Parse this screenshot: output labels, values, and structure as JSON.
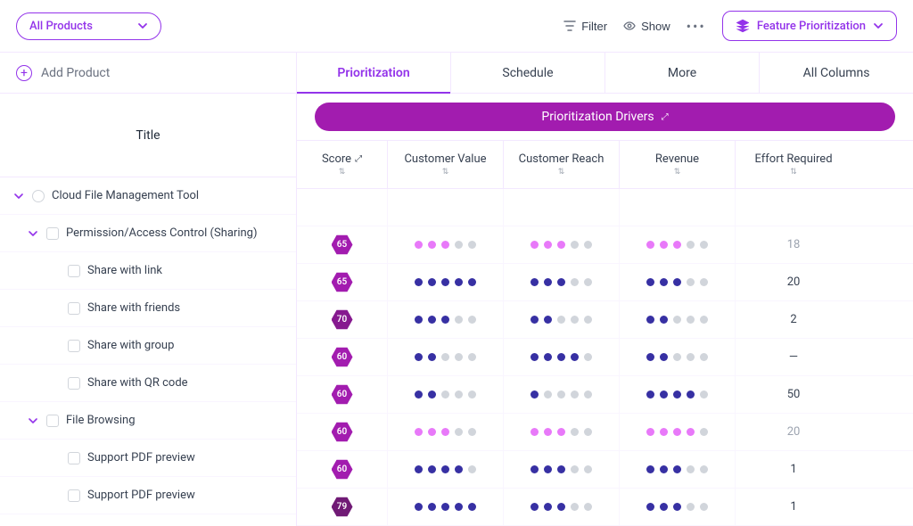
{
  "topbar": {
    "product_select": "All Products",
    "filter": "Filter",
    "show": "Show",
    "feature_btn": "Feature Prioritization"
  },
  "left": {
    "add_product": "Add Product",
    "title_header": "Title"
  },
  "tabs": [
    "Prioritization",
    "Schedule",
    "More",
    "All Columns"
  ],
  "drivers_header": "Prioritization Drivers",
  "columns": {
    "score": "Score",
    "cv": "Customer Value",
    "cr": "Customer Reach",
    "rev": "Revenue",
    "eff": "Effort Required"
  },
  "rows": [
    {
      "level": 1,
      "type": "product",
      "title": "Cloud File Management Tool",
      "expandable": true,
      "score": null
    },
    {
      "level": 2,
      "type": "feature",
      "title": "Permission/Access Control (Sharing)",
      "expandable": true,
      "score": 65,
      "hex": "#a21caf",
      "pink": true,
      "cv": 3,
      "cr": 3,
      "rev": 3,
      "eff": "18",
      "muted": true
    },
    {
      "level": 3,
      "type": "item",
      "title": "Share with link",
      "score": 65,
      "hex": "#a21caf",
      "cv": 5,
      "cr": 3,
      "rev": 3,
      "eff": "20"
    },
    {
      "level": 3,
      "type": "item",
      "title": "Share with friends",
      "score": 70,
      "hex": "#86198f",
      "cv": 3,
      "cr": 2,
      "rev": 2,
      "eff": "2"
    },
    {
      "level": 3,
      "type": "item",
      "title": "Share with group",
      "score": 60,
      "hex": "#a21caf",
      "cv": 2,
      "cr": 4,
      "rev": 2,
      "eff": "—"
    },
    {
      "level": 3,
      "type": "item",
      "title": "Share with QR code",
      "score": 60,
      "hex": "#a21caf",
      "cv": 2,
      "cr": 1,
      "rev": 4,
      "eff": "50"
    },
    {
      "level": 2,
      "type": "feature",
      "title": "File Browsing",
      "expandable": true,
      "score": 60,
      "hex": "#a21caf",
      "pink": true,
      "cv": 3,
      "cr": 3,
      "rev": 4,
      "eff": "20",
      "muted": true
    },
    {
      "level": 3,
      "type": "item",
      "title": "Support PDF preview",
      "score": 60,
      "hex": "#a21caf",
      "cv": 4,
      "cr": 3,
      "rev": 3,
      "eff": "1"
    },
    {
      "level": 3,
      "type": "item",
      "title": "Support PDF preview",
      "score": 79,
      "hex": "#701a75",
      "cv": 5,
      "cr": 3,
      "rev": 3,
      "eff": "1"
    }
  ],
  "chart_data": {
    "type": "table",
    "title": "Feature Prioritization",
    "columns": [
      "Title",
      "Score",
      "Customer Value",
      "Customer Reach",
      "Revenue",
      "Effort Required"
    ],
    "scale": "1-5 dots",
    "rows": [
      {
        "title": "Permission/Access Control (Sharing)",
        "score": 65,
        "customer_value": 3,
        "customer_reach": 3,
        "revenue": 3,
        "effort": 18
      },
      {
        "title": "Share with link",
        "score": 65,
        "customer_value": 5,
        "customer_reach": 3,
        "revenue": 3,
        "effort": 20
      },
      {
        "title": "Share with friends",
        "score": 70,
        "customer_value": 3,
        "customer_reach": 2,
        "revenue": 2,
        "effort": 2
      },
      {
        "title": "Share with group",
        "score": 60,
        "customer_value": 2,
        "customer_reach": 4,
        "revenue": 2,
        "effort": null
      },
      {
        "title": "Share with QR code",
        "score": 60,
        "customer_value": 2,
        "customer_reach": 1,
        "revenue": 4,
        "effort": 50
      },
      {
        "title": "File Browsing",
        "score": 60,
        "customer_value": 3,
        "customer_reach": 3,
        "revenue": 4,
        "effort": 20
      },
      {
        "title": "Support PDF preview",
        "score": 60,
        "customer_value": 4,
        "customer_reach": 3,
        "revenue": 3,
        "effort": 1
      },
      {
        "title": "Support PDF preview",
        "score": 79,
        "customer_value": 5,
        "customer_reach": 3,
        "revenue": 3,
        "effort": 1
      }
    ]
  }
}
